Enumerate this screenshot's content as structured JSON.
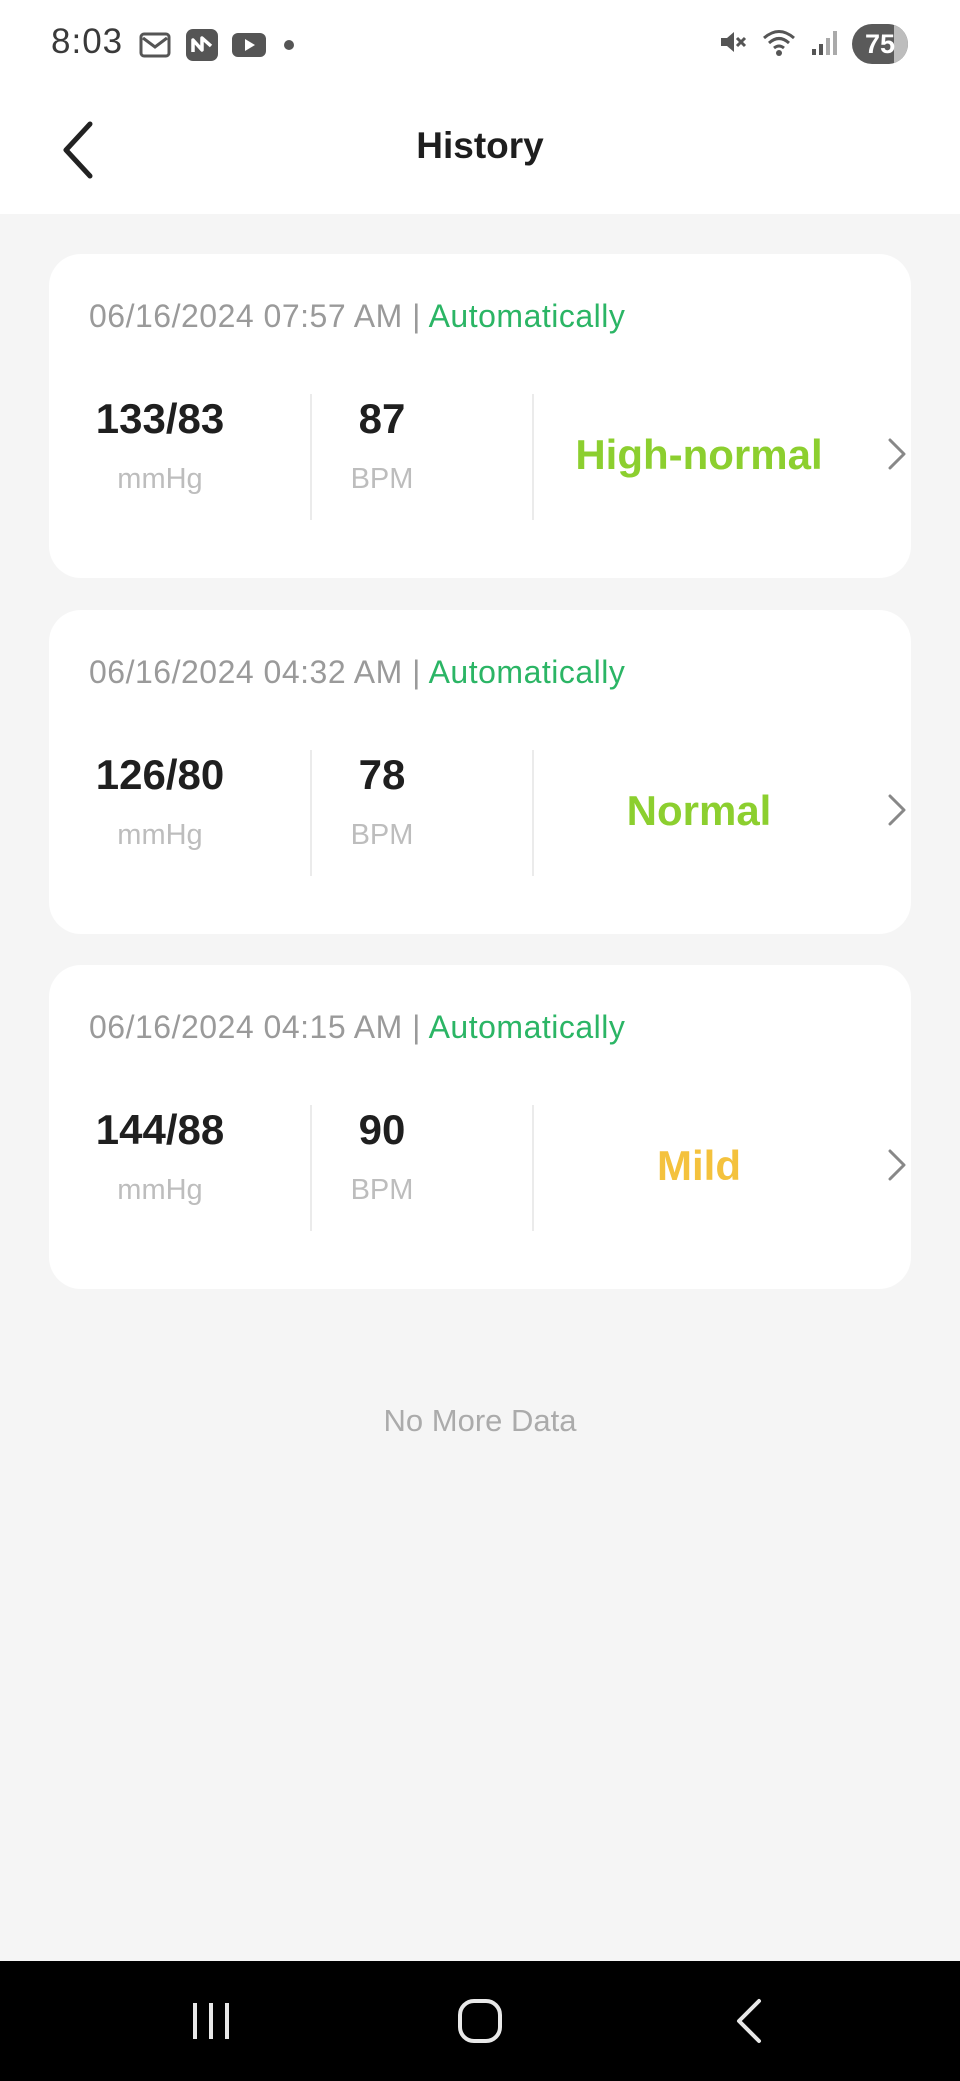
{
  "status_bar": {
    "time": "8:03",
    "battery": "75",
    "left_icons": [
      "mail-icon",
      "app-icon",
      "youtube-icon",
      "dot-icon"
    ],
    "right_icons": [
      "mute-icon",
      "wifi-icon",
      "signal-icon",
      "battery-icon"
    ]
  },
  "header": {
    "title": "History"
  },
  "records": [
    {
      "datetime": "06/16/2024 07:57 AM",
      "separator": " | ",
      "mode": "Automatically",
      "bp": "133/83",
      "bp_unit": "mmHg",
      "hr": "87",
      "hr_unit": "BPM",
      "status": "High-normal",
      "status_color": "#8ccf2f"
    },
    {
      "datetime": "06/16/2024 04:32 AM",
      "separator": " | ",
      "mode": "Automatically",
      "bp": "126/80",
      "bp_unit": "mmHg",
      "hr": "78",
      "hr_unit": "BPM",
      "status": "Normal",
      "status_color": "#8ccf2f"
    },
    {
      "datetime": "06/16/2024 04:15 AM",
      "separator": " | ",
      "mode": "Automatically",
      "bp": "144/88",
      "bp_unit": "mmHg",
      "hr": "90",
      "hr_unit": "BPM",
      "status": "Mild",
      "status_color": "#f4c23d"
    }
  ],
  "footer_text": "No More Data",
  "colors": {
    "mode_green": "#2bb565",
    "background": "#f5f5f5"
  }
}
